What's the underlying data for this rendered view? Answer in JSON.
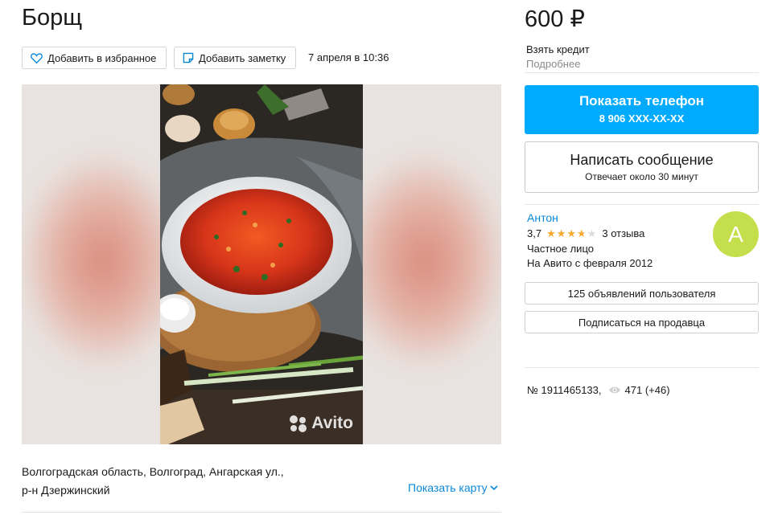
{
  "listing": {
    "title": "Борщ",
    "date": "7 апреля в 10:36",
    "favorite_label": "Добавить в избранное",
    "note_label": "Добавить заметку",
    "watermark": "Avito",
    "address_line1": "Волгоградская область, Волгоград, Ангарская ул.,",
    "address_line2": "р-н Дзержинский",
    "show_map": "Показать карту"
  },
  "sidebar": {
    "price": "600 ₽",
    "credit": "Взять кредит",
    "credit_more": "Подробнее",
    "phone_button": "Показать телефон",
    "phone_number": "8 906 XXX-XX-XX",
    "message_button": "Написать сообщение",
    "message_sub": "Отвечает около 30 минут",
    "seller": {
      "name": "Антон",
      "rating": "3,7",
      "rating_value": 3.7,
      "reviews": "3 отзыва",
      "type": "Частное лицо",
      "since": "На Авито с февраля 2012",
      "avatar_letter": "А",
      "avatar_color": "#c5de4b"
    },
    "listings_button": "125 объявлений пользователя",
    "subscribe_button": "Подписаться на продавца",
    "ad_number": "№ 1911465133,",
    "views": "471 (+46)"
  },
  "colors": {
    "accent": "#00aaff",
    "link": "#0a88d8",
    "star": "#f7a82d"
  }
}
